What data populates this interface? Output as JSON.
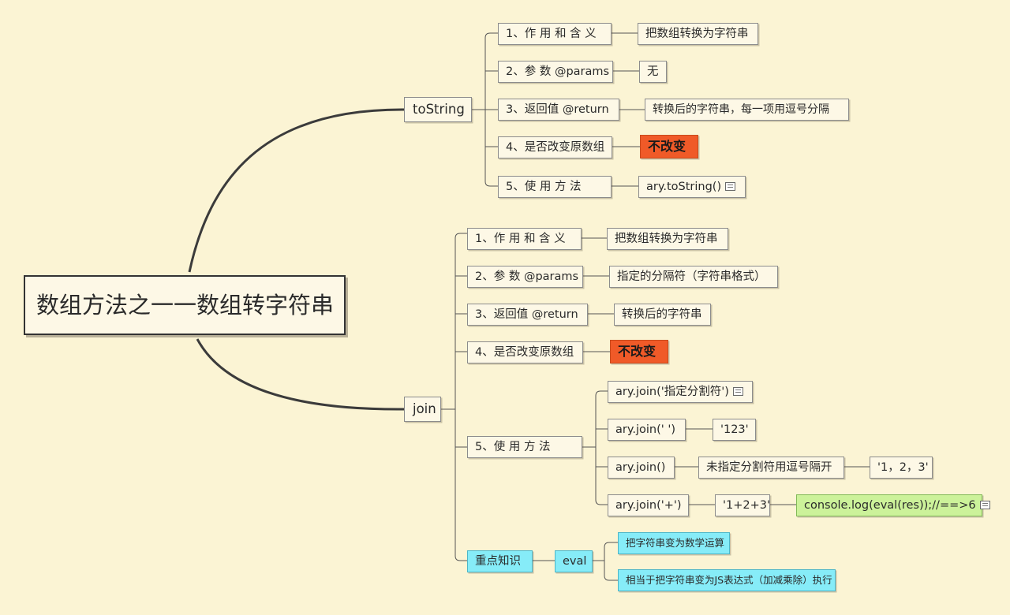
{
  "root": "数组方法之一一数组转字符串",
  "branches": {
    "tostring": {
      "label": "toString",
      "purpose": "1、作 用 和 含 义",
      "purpose_value": "把数组转换为字符串",
      "params": "2、参 数 @params",
      "params_value": "无",
      "ret": "3、返回值 @return",
      "ret_value": "转换后的字符串，每一项用逗号分隔",
      "mutates": "4、是否改变原数组",
      "mutates_value": "不改变",
      "usage": "5、使  用  方  法",
      "usage_value": "ary.toString()"
    },
    "join": {
      "label": "join",
      "purpose": "1、作 用 和 含 义",
      "purpose_value": "把数组转换为字符串",
      "params": "2、参 数 @params",
      "params_value": "指定的分隔符（字符串格式）",
      "ret": "3、返回值 @return",
      "ret_value": "转换后的字符串",
      "mutates": "4、是否改变原数组",
      "mutates_value": "不改变",
      "usage": "5、使  用  方  法",
      "usage_items": {
        "a": "ary.join('指定分割符')",
        "b": "ary.join(' ')",
        "b_result": "'123'",
        "c": "ary.join()",
        "c_note": "未指定分割符用逗号隔开",
        "c_result": "'1，2，3'",
        "d": "ary.join('+')",
        "d_result": "'1+2+3'",
        "d_eval": "console.log(eval(res));//==>6"
      },
      "key_point": "重点知识",
      "eval_label": "eval",
      "eval_desc_1": "把字符串变为数学运算",
      "eval_desc_2": "相当于把字符串变为JS表达式（加减乘除）执行"
    }
  },
  "colors": {
    "background": "#fbf4d4",
    "highlight_red": "#f05a28",
    "highlight_green": "#ccf29a",
    "highlight_cyan": "#86ecf8",
    "line": "#3b3b3b"
  }
}
